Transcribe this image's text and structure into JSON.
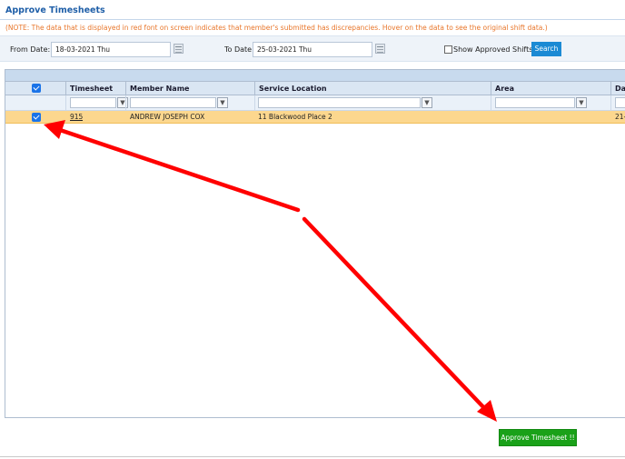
{
  "page": {
    "title": "Approve Timesheets",
    "note": "(NOTE: The data that is displayed in red font on screen indicates that member's submitted has discrepancies. Hover on the data to see the original shift data.)"
  },
  "filters": {
    "from_label": "From Date:",
    "from_value": "18-03-2021 Thu",
    "to_label": "To Date",
    "to_value": "25-03-2021 Thu",
    "show_approved_label": "Show Approved Shifts",
    "search_label": "Search"
  },
  "grid": {
    "columns": [
      "Timesheet",
      "Member Name",
      "Service Location",
      "Area",
      "Dat"
    ],
    "rows": [
      {
        "timesheet": "915",
        "member_name": "ANDREW JOSEPH COX",
        "service_location": "11 Blackwood Place 2",
        "area": "",
        "date": "21-"
      }
    ]
  },
  "actions": {
    "approve_label": "Approve Timesheet !!"
  },
  "colors": {
    "title": "#1f5fa8",
    "note": "#e8762b",
    "search_button": "#1b8ad4",
    "selected_row": "#fcd78e",
    "approve_button": "#1aa119",
    "annotation_arrow": "#ff0000"
  },
  "icons": [
    "calendar-icon",
    "filter-icon",
    "checkbox-checked-icon"
  ]
}
